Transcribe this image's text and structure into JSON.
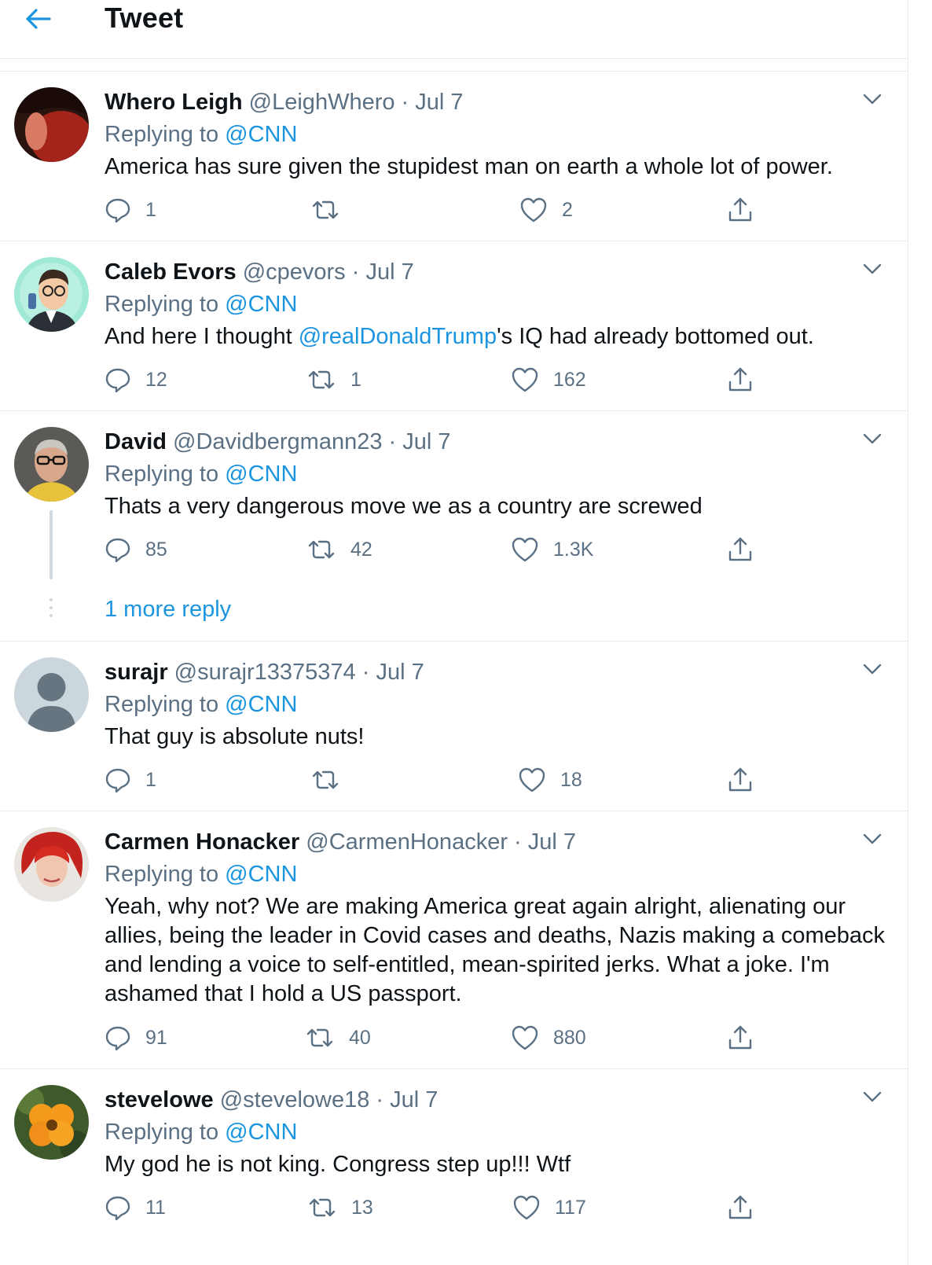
{
  "header": {
    "title": "Tweet",
    "back_icon": "arrow-left-icon"
  },
  "colors": {
    "accent": "#1b95e0",
    "muted": "#5b7083",
    "text": "#0f1419",
    "divider": "#e6ecf0"
  },
  "tweets": [
    {
      "name": "Whero Leigh",
      "handle": "@LeighWhero",
      "dot": "·",
      "date": "Jul 7",
      "replying_prefix": "Replying to ",
      "replying_to": "@CNN",
      "text": "America has sure given the stupidest man on earth a whole lot of power.",
      "replies": "1",
      "retweets": "",
      "likes": "2"
    },
    {
      "name": "Caleb Evors",
      "handle": "@cpevors",
      "dot": "·",
      "date": "Jul 7",
      "replying_prefix": "Replying to ",
      "replying_to": "@CNN",
      "text_before": "And here I thought ",
      "text_mention": "@realDonaldTrump",
      "text_after": "'s IQ had already bottomed out.",
      "replies": "12",
      "retweets": "1",
      "likes": "162"
    },
    {
      "name": "David",
      "handle": "@Davidbergmann23",
      "dot": "·",
      "date": "Jul 7",
      "replying_prefix": "Replying to ",
      "replying_to": "@CNN",
      "text": "Thats a very dangerous move we as a country are screwed",
      "replies": "85",
      "retweets": "42",
      "likes": "1.3K",
      "more_replies": "1 more reply"
    },
    {
      "name": "surajr",
      "handle": "@surajr13375374",
      "dot": "·",
      "date": "Jul 7",
      "replying_prefix": "Replying to ",
      "replying_to": "@CNN",
      "text": "That guy is absolute nuts!",
      "replies": "1",
      "retweets": "",
      "likes": "18"
    },
    {
      "name": "Carmen Honacker",
      "handle": "@CarmenHonacker",
      "dot": "·",
      "date": "Jul 7",
      "replying_prefix": "Replying to ",
      "replying_to": "@CNN",
      "text": "Yeah, why not? We are making America great again alright, alienating our allies, being the leader in Covid cases and deaths, Nazis making a comeback and lending a voice to self-entitled, mean-spirited jerks. What a joke. I'm ashamed that I hold a US passport.",
      "replies": "91",
      "retweets": "40",
      "likes": "880"
    },
    {
      "name": "stevelowe",
      "handle": "@stevelowe18",
      "dot": "·",
      "date": "Jul 7",
      "replying_prefix": "Replying to ",
      "replying_to": "@CNN",
      "text": "My god he is not king. Congress step up!!! Wtf",
      "replies": "11",
      "retweets": "13",
      "likes": "117"
    }
  ]
}
